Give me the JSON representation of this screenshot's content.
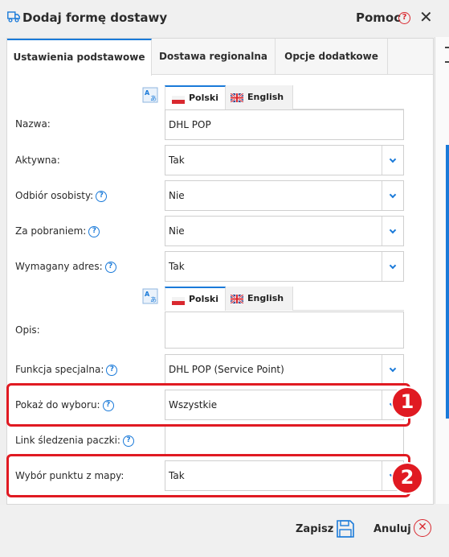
{
  "header": {
    "title": "Dodaj formę dostawy",
    "help_label": "Pomoc",
    "help_icon": "?",
    "close_icon": "✕"
  },
  "tabs": [
    {
      "label": "Ustawienia podstawowe"
    },
    {
      "label": "Dostawa regionalna"
    },
    {
      "label": "Opcje dodatkowe"
    }
  ],
  "languages": {
    "polish": "Polski",
    "english": "English"
  },
  "form": {
    "nazwa": {
      "label": "Nazwa:",
      "value": "DHL POP"
    },
    "aktywna": {
      "label": "Aktywna:",
      "value": "Tak"
    },
    "odbior": {
      "label": "Odbiór osobisty:",
      "value": "Nie"
    },
    "pobranie": {
      "label": "Za pobraniem:",
      "value": "Nie"
    },
    "adres": {
      "label": "Wymagany adres:",
      "value": "Tak"
    },
    "opis": {
      "label": "Opis:",
      "value": ""
    },
    "funkcja": {
      "label": "Funkcja specjalna:",
      "value": "DHL POP (Service Point)"
    },
    "pokaz": {
      "label": "Pokaż do wyboru:",
      "value": "Wszystkie"
    },
    "link": {
      "label": "Link śledzenia paczki:",
      "value": ""
    },
    "wybor": {
      "label": "Wybór punktu z mapy:",
      "value": "Tak"
    }
  },
  "annotations": {
    "one": "1",
    "two": "2"
  },
  "footer": {
    "save_label": "Zapisz",
    "cancel_label": "Anuluj",
    "cancel_icon": "✕"
  },
  "colors": {
    "accent": "#1a7ad9",
    "highlight": "#e01a22"
  }
}
